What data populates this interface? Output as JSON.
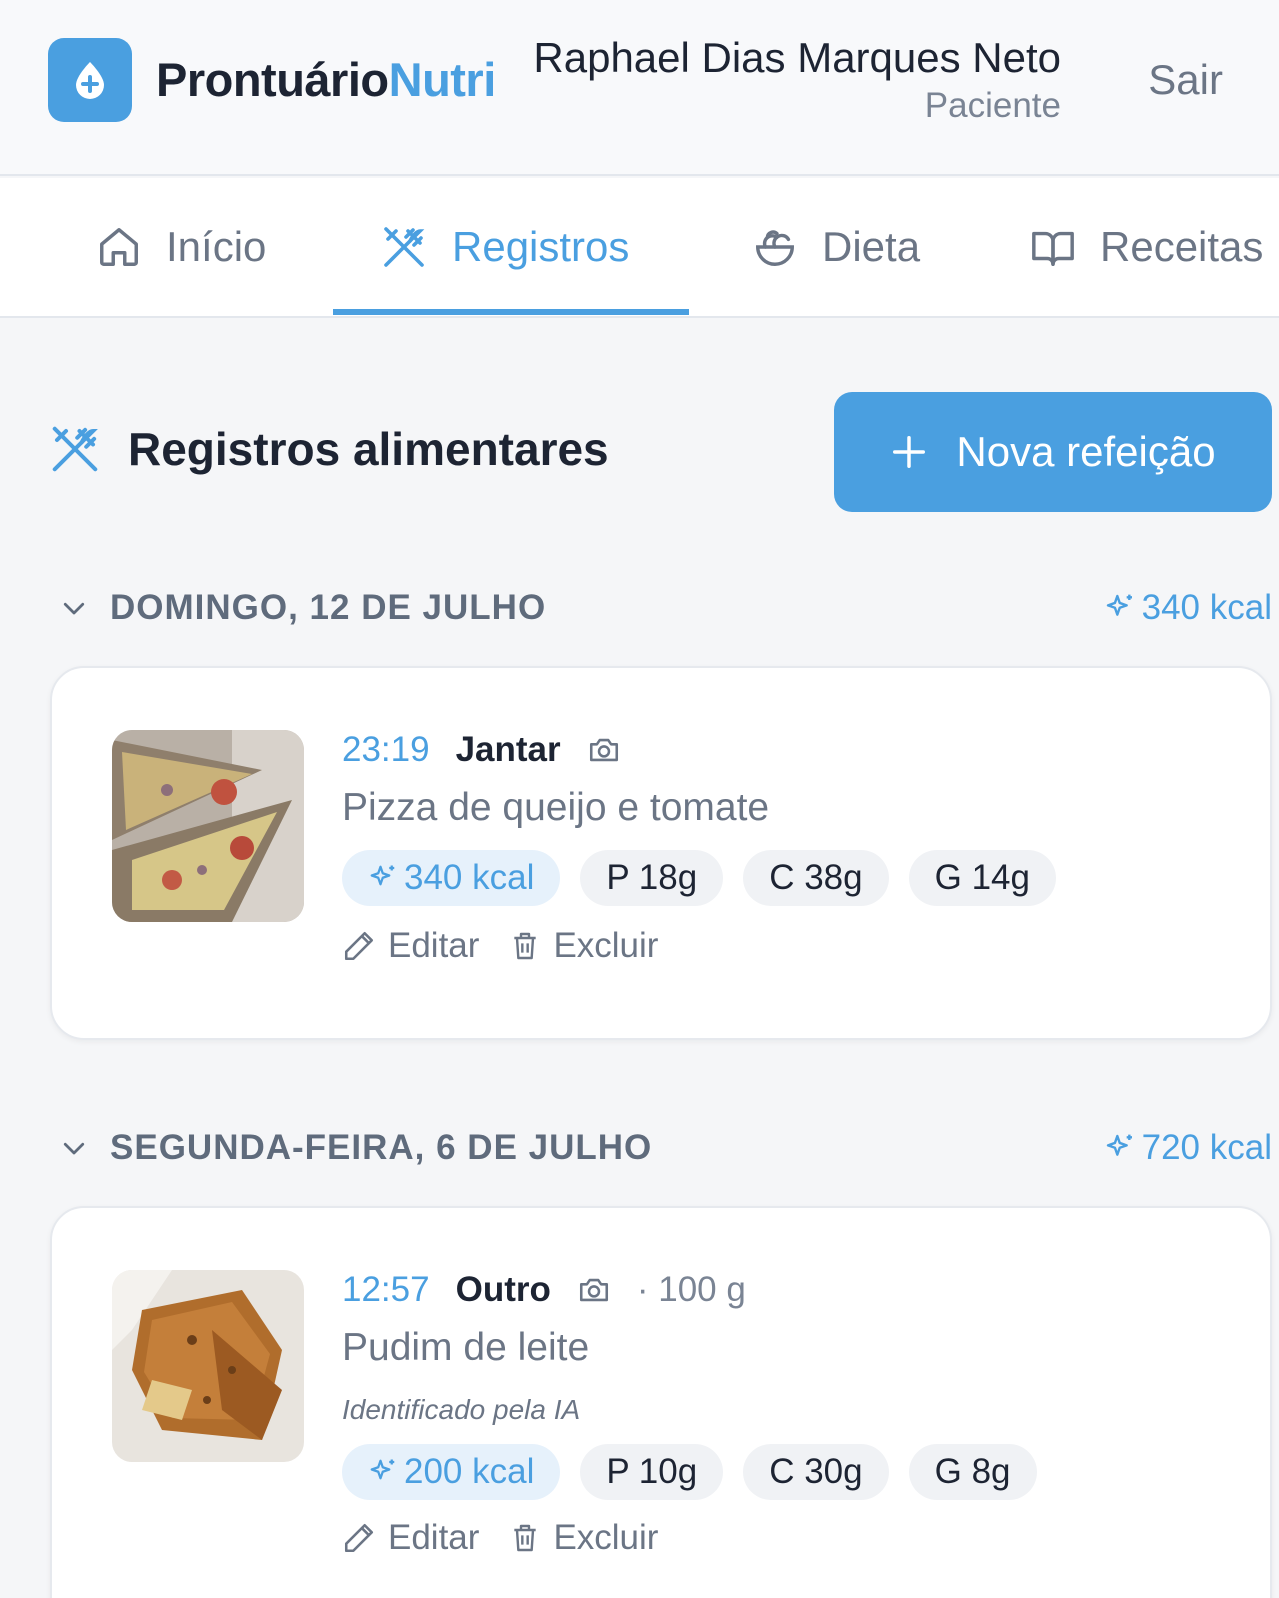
{
  "header": {
    "brand_part1": "Prontuário",
    "brand_part2": "Nutri",
    "user_name": "Raphael Dias Marques Neto",
    "user_role": "Paciente",
    "logout_label": "Sair",
    "accent_color": "#4a9fe0"
  },
  "nav": {
    "tabs": [
      {
        "label": "Início",
        "icon": "home-icon",
        "active": false
      },
      {
        "label": "Registros",
        "icon": "utensils-crossed-icon",
        "active": true
      },
      {
        "label": "Dieta",
        "icon": "salad-icon",
        "active": false
      },
      {
        "label": "Receitas",
        "icon": "book-open-icon",
        "active": false
      }
    ]
  },
  "main": {
    "title": "Registros alimentares",
    "new_button_label": "Nova refeição",
    "days": [
      {
        "label": "DOMINGO, 12 DE JULHO",
        "total_kcal": "340 kcal",
        "meals": [
          {
            "time": "23:19",
            "type": "Jantar",
            "qty": "",
            "name": "Pizza de queijo e tomate",
            "ai_note": "",
            "kcal": "340 kcal",
            "protein": "P 18g",
            "carbs": "C 38g",
            "fat": "G 14g",
            "edit_label": "Editar",
            "delete_label": "Excluir"
          }
        ]
      },
      {
        "label": "SEGUNDA-FEIRA, 6 DE JULHO",
        "total_kcal": "720 kcal",
        "meals": [
          {
            "time": "12:57",
            "type": "Outro",
            "qty": "· 100 g",
            "name": "Pudim de leite",
            "ai_note": "Identificado pela IA",
            "kcal": "200 kcal",
            "protein": "P 10g",
            "carbs": "C 30g",
            "fat": "G 8g",
            "edit_label": "Editar",
            "delete_label": "Excluir"
          }
        ]
      }
    ]
  }
}
